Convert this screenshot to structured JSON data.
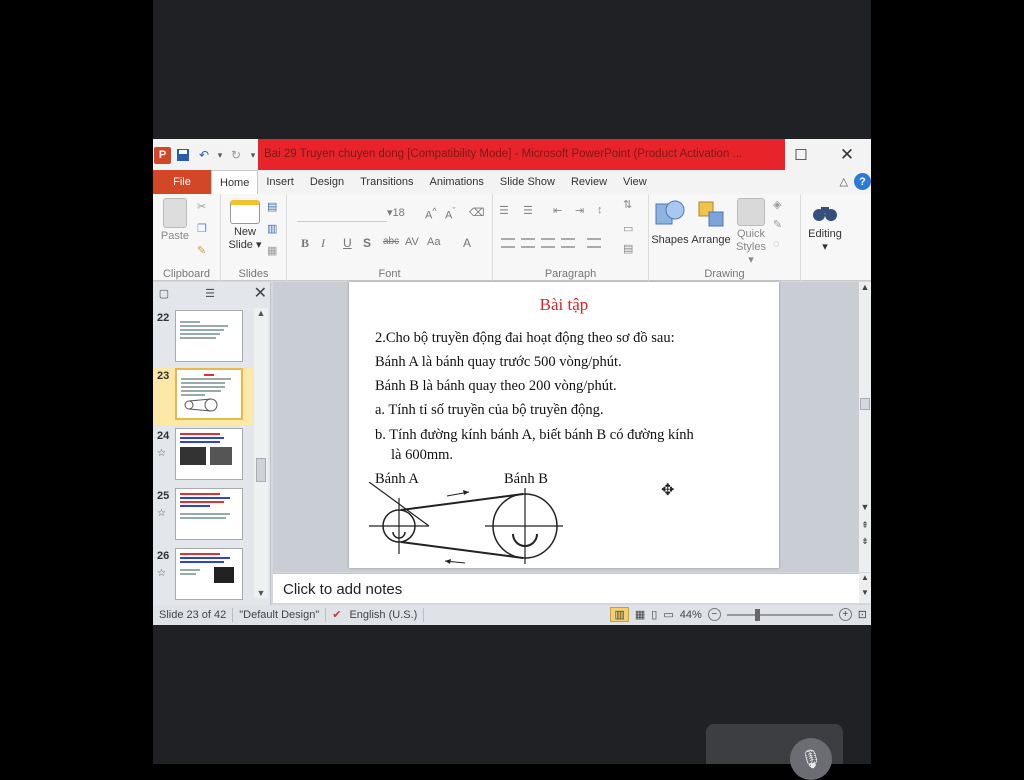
{
  "window": {
    "title": "Bai 29 Truyen chuyen dong [Compatibility Mode]  -  Microsoft PowerPoint (Product Activation ..."
  },
  "tabs": [
    "File",
    "Home",
    "Insert",
    "Design",
    "Transitions",
    "Animations",
    "Slide Show",
    "Review",
    "View"
  ],
  "ribbon": {
    "clipboard": {
      "paste": "Paste",
      "label": "Clipboard"
    },
    "slides": {
      "new_slide_1": "New",
      "new_slide_2": "Slide ▾",
      "label": "Slides"
    },
    "font": {
      "size": "18",
      "label": "Font"
    },
    "paragraph": {
      "label": "Paragraph"
    },
    "drawing": {
      "shapes": "Shapes",
      "arrange": "Arrange",
      "quick_styles_1": "Quick",
      "quick_styles_2": "Styles ▾",
      "label": "Drawing"
    },
    "editing": {
      "label": "Editing"
    }
  },
  "thumbnails": [
    {
      "num": "22",
      "selected": false
    },
    {
      "num": "23",
      "selected": true
    },
    {
      "num": "24",
      "selected": false
    },
    {
      "num": "25",
      "selected": false
    },
    {
      "num": "26",
      "selected": false
    }
  ],
  "slide": {
    "title": "Bài tập",
    "lines": [
      "2.Cho bộ truyền động đai hoạt động theo sơ đồ sau:",
      "Bánh A là bánh quay trước 500 vòng/phút.",
      "Bánh B là bánh quay theo 200 vòng/phút.",
      "a. Tính tỉ số truyền của bộ truyền động.",
      "b. Tính đường kính bánh A, biết bánh B có đường kính",
      "    là 600mm."
    ],
    "label_a": "Bánh A",
    "label_b": "Bánh B"
  },
  "notes": {
    "placeholder": "Click to add notes"
  },
  "status": {
    "slide": "Slide 23 of 42",
    "theme": "\"Default Design\"",
    "language": "English (U.S.)",
    "zoom": "44%"
  }
}
